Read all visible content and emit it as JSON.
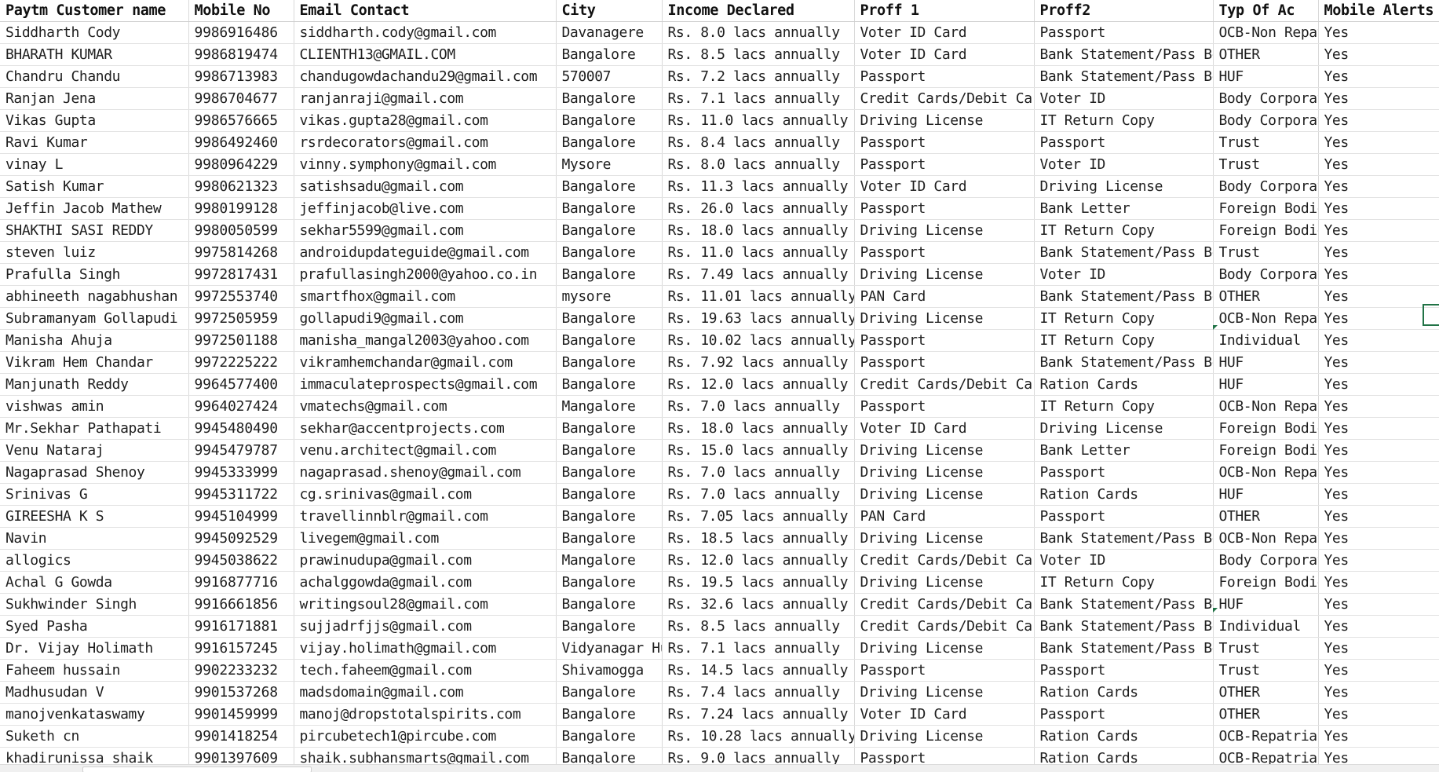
{
  "sheet": {
    "headers": [
      "Paytm Customer name",
      "Mobile No",
      "Email Contact",
      "City",
      "Income Declared",
      "Proff 1",
      "Proff2",
      "Typ Of Ac",
      "Mobile Alerts"
    ],
    "rows": [
      [
        "Siddharth Cody",
        "9986916486",
        "siddharth.cody@gmail.com",
        "Davanagere",
        "Rs. 8.0 lacs annually",
        "Voter ID Card",
        "Passport",
        "OCB-Non Repatriable",
        "Yes"
      ],
      [
        "BHARATH KUMAR",
        "9986819474",
        "CLIENTH13@GMAIL.COM",
        "Bangalore",
        "Rs. 8.5 lacs annually",
        "Voter ID Card",
        "Bank Statement/Pass Book",
        "OTHER",
        "Yes"
      ],
      [
        "Chandru Chandu",
        "9986713983",
        "chandugowdachandu29@gmail.com",
        "570007",
        "Rs. 7.2 lacs annually",
        "Passport",
        "Bank Statement/Pass Book",
        "HUF",
        "Yes"
      ],
      [
        "Ranjan Jena",
        "9986704677",
        "ranjanraji@gmail.com",
        "Bangalore",
        "Rs. 7.1 lacs annually",
        "Credit Cards/Debit Cards",
        "Voter ID",
        "Body Corporate",
        "Yes"
      ],
      [
        "Vikas Gupta",
        "9986576665",
        "vikas.gupta28@gmail.com",
        "Bangalore",
        "Rs. 11.0 lacs annually",
        "Driving License",
        "IT Return Copy",
        "Body Corporate",
        "Yes"
      ],
      [
        "Ravi Kumar",
        "9986492460",
        "rsrdecorators@gmail.com",
        "Bangalore",
        "Rs. 8.4 lacs annually",
        "Passport",
        "Passport",
        "Trust",
        "Yes"
      ],
      [
        "vinay L",
        "9980964229",
        "vinny.symphony@gmail.com",
        "Mysore",
        "Rs. 8.0 lacs annually",
        "Passport",
        "Voter ID",
        "Trust",
        "Yes"
      ],
      [
        "Satish Kumar",
        "9980621323",
        "satishsadu@gmail.com",
        "Bangalore",
        "Rs. 11.3 lacs annually",
        "Voter ID Card",
        "Driving License",
        "Body Corporate",
        "Yes"
      ],
      [
        "Jeffin Jacob Mathew",
        "9980199128",
        "jeffinjacob@live.com",
        "Bangalore",
        "Rs. 26.0 lacs annually",
        "Passport",
        "Bank Letter",
        "Foreign Bodies",
        "Yes"
      ],
      [
        "SHAKTHI SASI REDDY",
        "9980050599",
        "sekhar5599@gmail.com",
        "Bangalore",
        "Rs. 18.0 lacs annually",
        "Driving License",
        "IT Return Copy",
        "Foreign Bodies",
        "Yes"
      ],
      [
        "steven luiz",
        "9975814268",
        "androidupdateguide@gmail.com",
        "Bangalore",
        "Rs. 11.0 lacs annually",
        "Passport",
        "Bank Statement/Pass Book",
        "Trust",
        "Yes"
      ],
      [
        "Prafulla Singh",
        "9972817431",
        "prafullasingh2000@yahoo.co.in",
        "Bangalore",
        "Rs. 7.49 lacs annually",
        "Driving License",
        "Voter ID",
        "Body Corporate",
        "Yes"
      ],
      [
        "abhineeth nagabhushan",
        "9972553740",
        "smartfhox@gmail.com",
        "mysore",
        "Rs. 11.01 lacs annually",
        "PAN Card",
        "Bank Statement/Pass Book",
        "OTHER",
        "Yes"
      ],
      [
        "Subramanyam Gollapudi",
        "9972505959",
        "gollapudi9@gmail.com",
        "Bangalore",
        "Rs. 19.63 lacs annually",
        "Driving License",
        "IT Return Copy",
        "OCB-Non Repatriable",
        "Yes"
      ],
      [
        "Manisha Ahuja",
        "9972501188",
        "manisha_mangal2003@yahoo.com",
        "Bangalore",
        "Rs. 10.02 lacs annually",
        "Passport",
        "IT Return Copy",
        "Individual",
        "Yes"
      ],
      [
        "Vikram Hem Chandar",
        "9972225222",
        "vikramhemchandar@gmail.com",
        "Bangalore",
        "Rs. 7.92 lacs annually",
        "Passport",
        "Bank Statement/Pass Book",
        "HUF",
        "Yes"
      ],
      [
        "Manjunath Reddy",
        "9964577400",
        "immaculateprospects@gmail.com",
        "Bangalore",
        "Rs. 12.0 lacs annually",
        "Credit Cards/Debit Cards",
        "Ration Cards",
        "HUF",
        "Yes"
      ],
      [
        "vishwas amin",
        "9964027424",
        "vmatechs@gmail.com",
        "Mangalore",
        "Rs. 7.0 lacs annually",
        "Passport",
        "IT Return Copy",
        "OCB-Non Repatriable",
        "Yes"
      ],
      [
        "Mr.Sekhar Pathapati",
        "9945480490",
        "sekhar@accentprojects.com",
        "Bangalore",
        "Rs. 18.0 lacs annually",
        "Voter ID Card",
        "Driving License",
        "Foreign Bodies",
        "Yes"
      ],
      [
        "Venu Nataraj",
        "9945479787",
        "venu.architect@gmail.com",
        "Bangalore",
        "Rs. 15.0 lacs annually",
        "Driving License",
        "Bank Letter",
        "Foreign Bodies",
        "Yes"
      ],
      [
        "Nagaprasad Shenoy",
        "9945333999",
        "nagaprasad.shenoy@gmail.com",
        "Bangalore",
        "Rs. 7.0 lacs annually",
        "Driving License",
        "Passport",
        "OCB-Non Repatriable",
        "Yes"
      ],
      [
        "Srinivas G",
        "9945311722",
        "cg.srinivas@gmail.com",
        "Bangalore",
        "Rs. 7.0 lacs annually",
        "Driving License",
        "Ration Cards",
        "HUF",
        "Yes"
      ],
      [
        "GIREESHA K S",
        "9945104999",
        "travellinnblr@gmail.com",
        "Bangalore",
        "Rs. 7.05 lacs annually",
        "PAN Card",
        "Passport",
        "OTHER",
        "Yes"
      ],
      [
        "Navin",
        "9945092529",
        "livegem@gmail.com",
        "Bangalore",
        "Rs. 18.5 lacs annually",
        "Driving License",
        "Bank Statement/Pass Book",
        "OCB-Non Repatriable",
        "Yes"
      ],
      [
        "allogics",
        "9945038622",
        "prawinudupa@gmail.com",
        "Mangalore",
        "Rs. 12.0 lacs annually",
        "Credit Cards/Debit Cards",
        "Voter ID",
        "Body Corporate",
        "Yes"
      ],
      [
        "Achal G Gowda",
        "9916877716",
        "achalggowda@gmail.com",
        "Bangalore",
        "Rs. 19.5 lacs annually",
        "Driving License",
        "IT Return Copy",
        "Foreign Bodies",
        "Yes"
      ],
      [
        "Sukhwinder Singh",
        "9916661856",
        "writingsoul28@gmail.com",
        "Bangalore",
        "Rs. 32.6 lacs annually",
        "Credit Cards/Debit Cards",
        "Bank Statement/Pass Book",
        "HUF",
        "Yes"
      ],
      [
        "Syed Pasha",
        "9916171881",
        "sujjadrfjjs@gmail.com",
        "Bangalore",
        "Rs. 8.5 lacs annually",
        "Credit Cards/Debit Cards",
        "Bank Statement/Pass Book",
        "Individual",
        "Yes"
      ],
      [
        "Dr. Vijay Holimath",
        "9916157245",
        "vijay.holimath@gmail.com",
        "Vidyanagar Hubli",
        "Rs. 7.1 lacs annually",
        "Driving License",
        "Bank Statement/Pass Book",
        "Trust",
        "Yes"
      ],
      [
        "Faheem hussain",
        "9902233232",
        "tech.faheem@gmail.com",
        "Shivamogga",
        "Rs. 14.5 lacs annually",
        "Passport",
        "Passport",
        "Trust",
        "Yes"
      ],
      [
        "Madhusudan V",
        "9901537268",
        "madsdomain@gmail.com",
        "Bangalore",
        "Rs. 7.4 lacs annually",
        "Driving License",
        "Ration Cards",
        "OTHER",
        "Yes"
      ],
      [
        "manojvenkataswamy",
        "9901459999",
        "manoj@dropstotalspirits.com",
        "Bangalore",
        "Rs. 7.24 lacs annually",
        "Voter ID Card",
        "Passport",
        "OTHER",
        "Yes"
      ],
      [
        "Suketh cn",
        "9901418254",
        "pircubetech1@pircube.com",
        "Bangalore",
        "Rs. 10.28 lacs annually",
        "Driving License",
        "Ration Cards",
        "OCB-Repatriable",
        "Yes"
      ],
      [
        "khadirunissa shaik",
        "9901397609",
        "shaik.subhansmarts@gmail.com",
        "Bangalore",
        "Rs. 9.0 lacs annually",
        "Passport",
        "Ration Cards",
        "OCB-Repatriable",
        "Yes"
      ]
    ]
  },
  "colors": {
    "selection": "#217346",
    "grid_line": "#d9d9d9",
    "text": "#1f1f1f"
  }
}
